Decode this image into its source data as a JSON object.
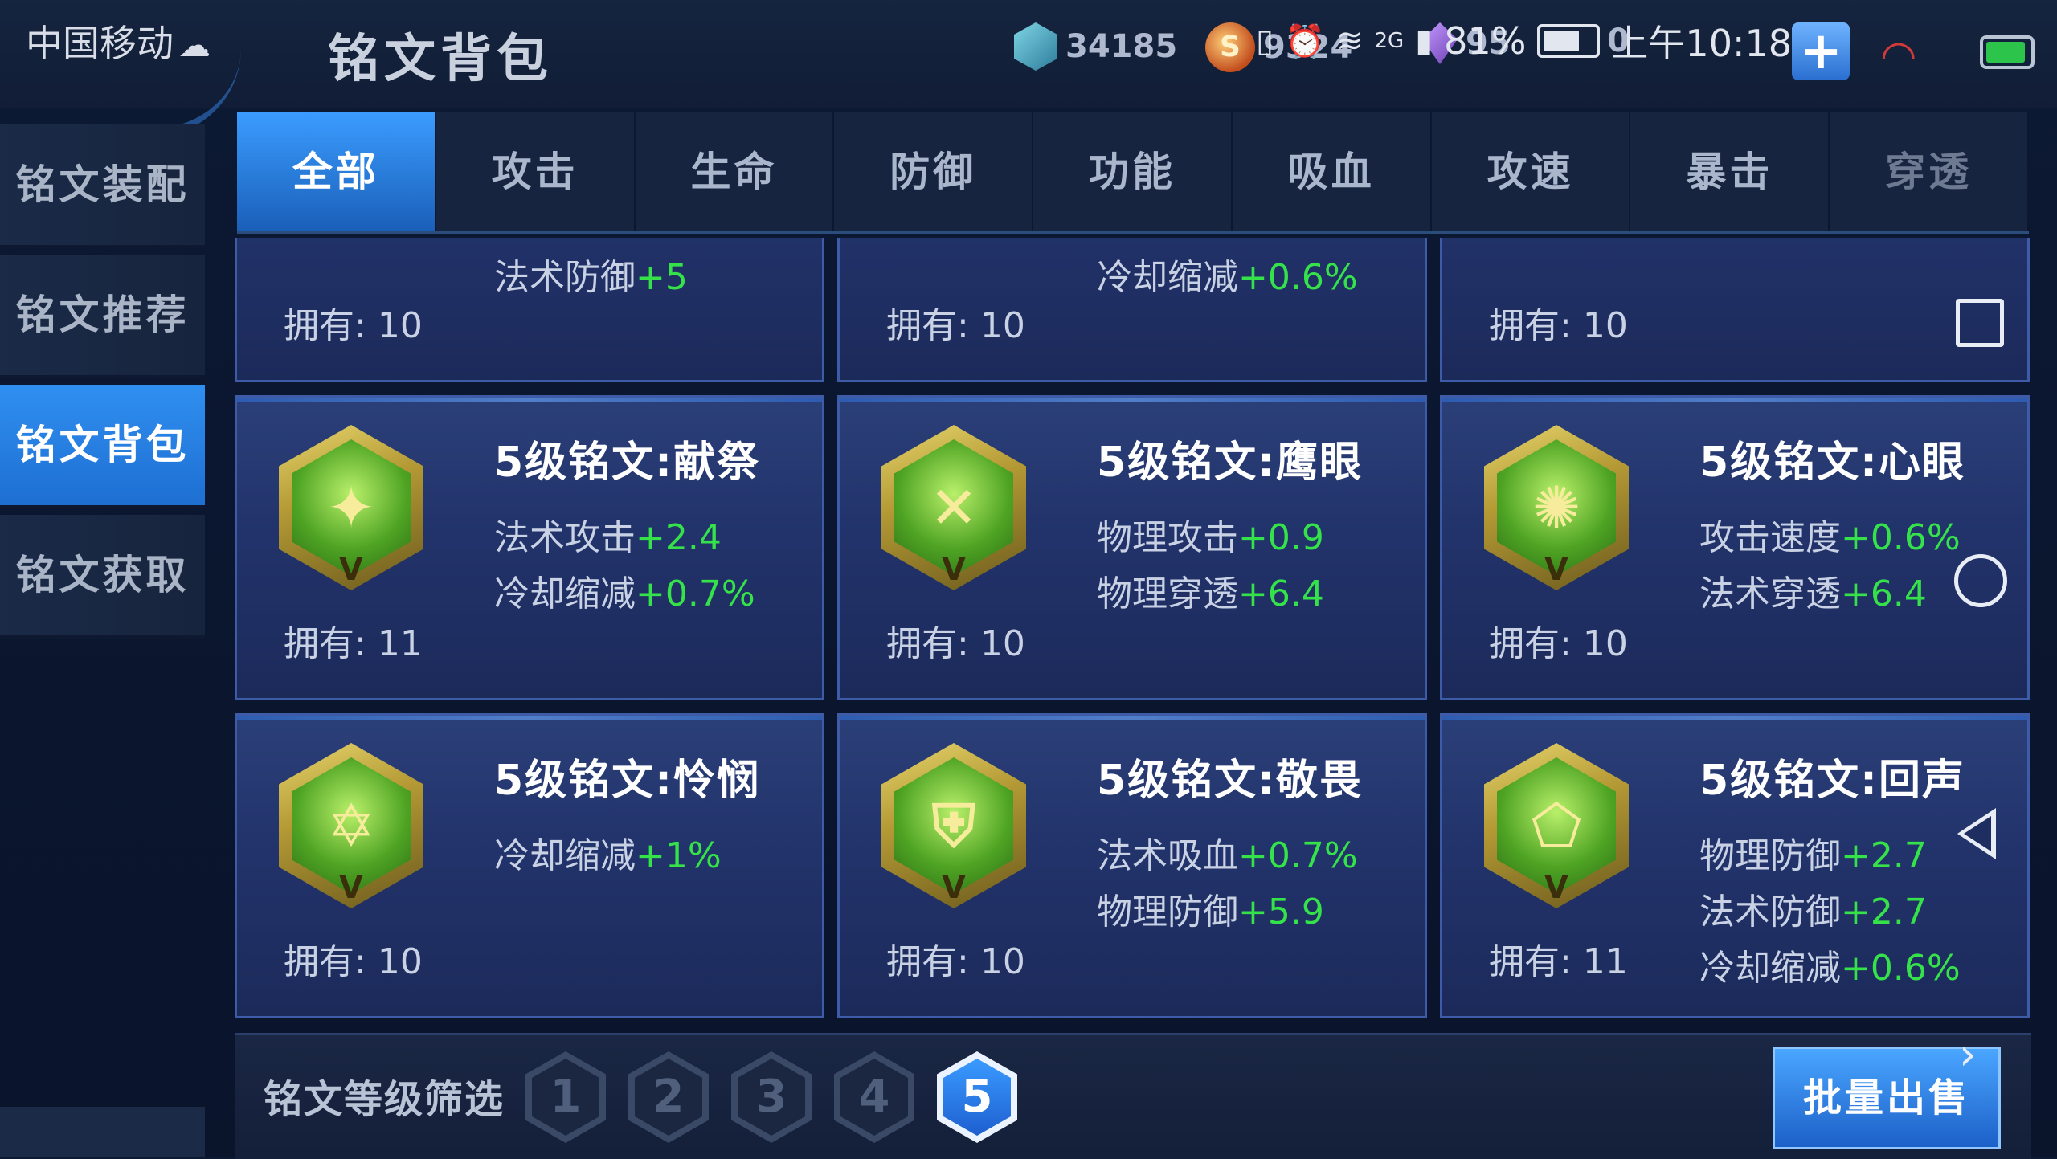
{
  "status_bar": {
    "carrier": "中国移动",
    "signal_text": "2G",
    "battery_pct": "81%",
    "time": "上午10:18"
  },
  "header": {
    "title": "铭文背包",
    "gems": "34185",
    "coins": "9324",
    "crystals": "95",
    "extra": "0"
  },
  "sidebar": {
    "items": [
      {
        "label": "铭文装配"
      },
      {
        "label": "铭文推荐"
      },
      {
        "label": "铭文背包"
      },
      {
        "label": "铭文获取"
      }
    ],
    "active_index": 2
  },
  "tabs": [
    {
      "label": "全部"
    },
    {
      "label": "攻击"
    },
    {
      "label": "生命"
    },
    {
      "label": "防御"
    },
    {
      "label": "功能"
    },
    {
      "label": "吸血"
    },
    {
      "label": "攻速"
    },
    {
      "label": "暴击"
    },
    {
      "label": "穿透"
    }
  ],
  "own_label": "拥有:",
  "cards_top_partial": [
    {
      "stats": [
        {
          "name": "法术防御",
          "value": "+5"
        }
      ],
      "owned": "10"
    },
    {
      "stats": [
        {
          "name": "冷却缩减",
          "value": "+0.6%"
        }
      ],
      "owned": "10"
    },
    {
      "stats": [],
      "owned": "10"
    }
  ],
  "cards": [
    {
      "name": "5级铭文:献祭",
      "stats": [
        {
          "name": "法术攻击",
          "value": "+2.4"
        },
        {
          "name": "冷却缩减",
          "value": "+0.7%"
        }
      ],
      "owned": "11"
    },
    {
      "name": "5级铭文:鹰眼",
      "stats": [
        {
          "name": "物理攻击",
          "value": "+0.9"
        },
        {
          "name": "物理穿透",
          "value": "+6.4"
        }
      ],
      "owned": "10"
    },
    {
      "name": "5级铭文:心眼",
      "stats": [
        {
          "name": "攻击速度",
          "value": "+0.6%"
        },
        {
          "name": "法术穿透",
          "value": "+6.4"
        }
      ],
      "owned": "10"
    },
    {
      "name": "5级铭文:怜悯",
      "stats": [
        {
          "name": "冷却缩减",
          "value": "+1%"
        }
      ],
      "owned": "10"
    },
    {
      "name": "5级铭文:敬畏",
      "stats": [
        {
          "name": "法术吸血",
          "value": "+0.7%"
        },
        {
          "name": "物理防御",
          "value": "+5.9"
        }
      ],
      "owned": "10"
    },
    {
      "name": "5级铭文:回声",
      "stats": [
        {
          "name": "物理防御",
          "value": "+2.7"
        },
        {
          "name": "法术防御",
          "value": "+2.7"
        },
        {
          "name": "冷却缩减",
          "value": "+0.6%"
        }
      ],
      "owned": "11"
    }
  ],
  "filter": {
    "label": "铭文等级筛选",
    "levels": [
      "1",
      "2",
      "3",
      "4",
      "5"
    ],
    "selected": "5",
    "bulk_sell_label": "批量出售"
  },
  "colors": {
    "accent_blue": "#2f8ff0",
    "stat_green": "#35e24a",
    "card_bg": "#22336b"
  }
}
